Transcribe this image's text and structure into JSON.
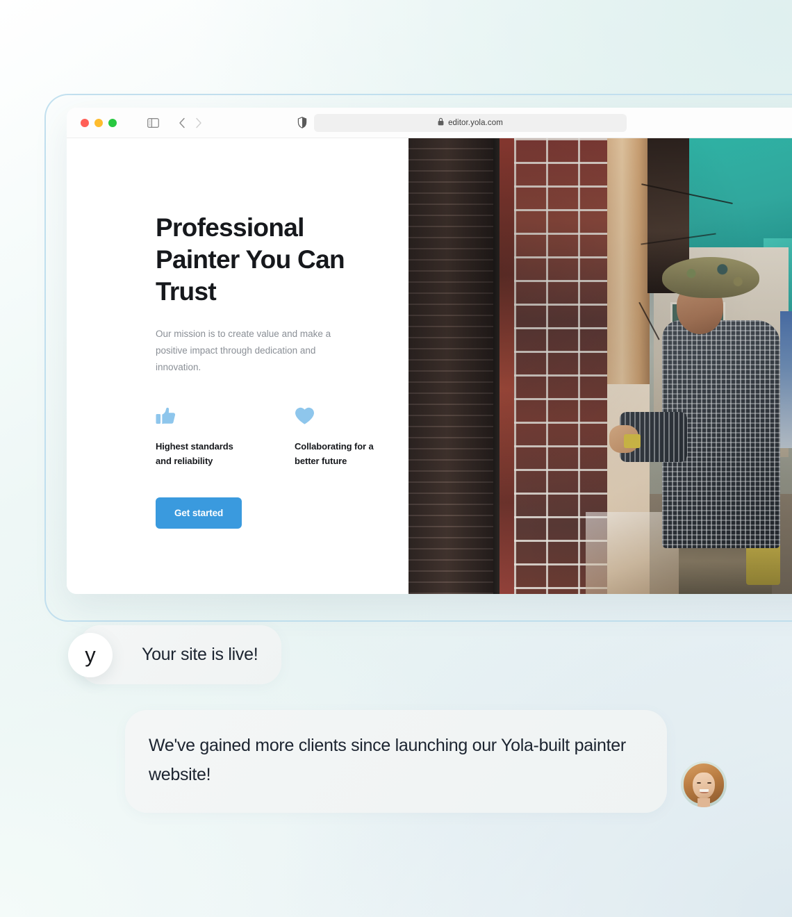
{
  "background": {
    "gradient_from": "#ffffff",
    "gradient_mid": "#e7f3f2",
    "gradient_to": "#f5fafb",
    "frame_border_color": "#c2e0ef"
  },
  "browser": {
    "traffic_lights": [
      {
        "name": "close",
        "color": "#ff5f57"
      },
      {
        "name": "minimize",
        "color": "#febc2e"
      },
      {
        "name": "zoom",
        "color": "#28c840"
      }
    ],
    "icons": {
      "sidebar": "sidebar-toggle-icon",
      "back": "back-chevron-icon",
      "forward": "forward-chevron-icon",
      "shield": "privacy-shield-icon",
      "lock": "lock-icon",
      "reload": "reload-icon"
    },
    "url": "editor.yola.com"
  },
  "site": {
    "headline": "Professional Painter You Can Trust",
    "subtext": "Our mission is to create value and make a positive impact through dedication and innovation.",
    "accent_color": "#3a9ade",
    "icon_color": "#8ec6ec",
    "features": [
      {
        "icon": "thumbs-up-icon",
        "label": "Highest standards and reliability"
      },
      {
        "icon": "heart-icon",
        "label": "Collaborating for a better future"
      }
    ],
    "cta_label": "Get started",
    "photo_alt": "painter-at-work-photo"
  },
  "chat": {
    "brand_avatar_letter": "y",
    "messages": [
      {
        "from": "brand",
        "text": "Your site is live!"
      },
      {
        "from": "user",
        "text": "We've gained more clients since launching our Yola-built painter website!"
      }
    ],
    "user_avatar": "smiling-woman-avatar"
  }
}
